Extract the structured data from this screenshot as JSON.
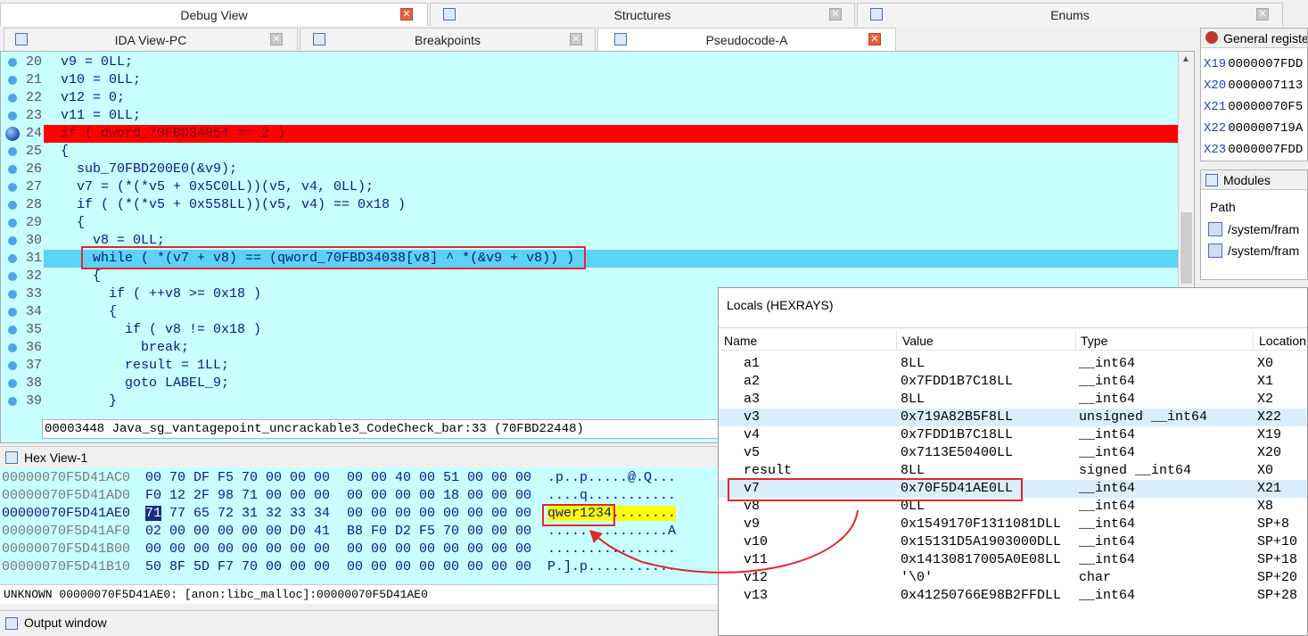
{
  "top_tabs": [
    {
      "label": "Debug View"
    },
    {
      "label": "Structures"
    },
    {
      "label": "Enums"
    }
  ],
  "sub_tabs": [
    {
      "label": "IDA View-PC"
    },
    {
      "label": "Breakpoints"
    },
    {
      "label": "Pseudocode-A"
    }
  ],
  "pseudocode": {
    "lines": [
      {
        "num": "20",
        "text": "v9 = 0LL;"
      },
      {
        "num": "21",
        "text": "v10 = 0LL;"
      },
      {
        "num": "22",
        "text": "v12 = 0;"
      },
      {
        "num": "23",
        "text": "v11 = 0LL;"
      },
      {
        "num": "24",
        "text": "if ( dword_70FBD34054 == 2 )"
      },
      {
        "num": "25",
        "text": "{"
      },
      {
        "num": "26",
        "text": "  sub_70FBD200E0(&v9);"
      },
      {
        "num": "27",
        "text": "  v7 = (*(*v5 + 0x5C0LL))(v5, v4, 0LL);"
      },
      {
        "num": "28",
        "text": "  if ( (*(*v5 + 0x558LL))(v5, v4) == 0x18 )"
      },
      {
        "num": "29",
        "text": "  {"
      },
      {
        "num": "30",
        "text": "    v8 = 0LL;"
      },
      {
        "num": "31",
        "text": "    while ( *(v7 + v8) == (qword_70FBD34038[v8] ^ *(&v9 + v8)) )"
      },
      {
        "num": "32",
        "text": "    {"
      },
      {
        "num": "33",
        "text": "      if ( ++v8 >= 0x18 )"
      },
      {
        "num": "34",
        "text": "      {"
      },
      {
        "num": "35",
        "text": "        if ( v8 != 0x18 )"
      },
      {
        "num": "36",
        "text": "          break;"
      },
      {
        "num": "37",
        "text": "        result = 1LL;"
      },
      {
        "num": "38",
        "text": "        goto LABEL_9;"
      },
      {
        "num": "39",
        "text": "      }"
      }
    ],
    "status": "00003448 Java_sg_vantagepoint_uncrackable3_CodeCheck_bar:33 (70FBD22448)"
  },
  "hex_view": {
    "title": "Hex View-1",
    "rows": [
      {
        "addr": "00000070F5D41AC0",
        "bytes1": "00 70 DF F5 70 00 00 00",
        "bytes2": "00 00 40 00 51 00 00 00",
        "ascii": ".p..p.....@.Q..."
      },
      {
        "addr": "00000070F5D41AD0",
        "bytes1": "F0 12 2F 98 71 00 00 00",
        "bytes2": "00 00 00 00 18 00 00 00",
        "ascii": "....q..........."
      },
      {
        "addr": "00000070F5D41AE0",
        "sel_byte": "71",
        "bytes1": " 77 65 72 31 32 33 34",
        "bytes2": "00 00 00 00 00 00 00 00",
        "ascii_hl": "qwer1234",
        "ascii": "........"
      },
      {
        "addr": "00000070F5D41AF0",
        "bytes1": "02 00 00 00 00 00 D0 41",
        "bytes2": "B8 F0 D2 F5 70 00 00 00",
        "ascii": "...............A"
      },
      {
        "addr": "00000070F5D41B00",
        "bytes1": "00 00 00 00 00 00 00 00",
        "bytes2": "00 00 00 00 00 00 00 00",
        "ascii": "................"
      },
      {
        "addr": "00000070F5D41B10",
        "bytes1": "50 8F 5D F7 70 00 00 00",
        "bytes2": "00 00 00 00 00 00 00 00",
        "ascii": "P.].p..........."
      }
    ],
    "status": "UNKNOWN 00000070F5D41AE0: [anon:libc_malloc]:00000070F5D41AE0"
  },
  "output_window": {
    "title": "Output window"
  },
  "registers": {
    "title": "General registe",
    "rows": [
      {
        "name": "X19",
        "value": "0000007FDD"
      },
      {
        "name": "X20",
        "value": "0000007113"
      },
      {
        "name": "X21",
        "value": "00000070F5"
      },
      {
        "name": "X22",
        "value": "000000719A"
      },
      {
        "name": "X23",
        "value": "0000007FDD"
      }
    ]
  },
  "modules": {
    "title": "Modules",
    "header": "Path",
    "rows": [
      {
        "path": "/system/fram"
      },
      {
        "path": "/system/fram"
      }
    ]
  },
  "locals": {
    "title": "Locals (HEXRAYS)",
    "columns": [
      "Name",
      "Value",
      "Type",
      "Location"
    ],
    "rows": [
      {
        "name": "a1",
        "value": "8LL",
        "type": "__int64",
        "loc": "X0"
      },
      {
        "name": "a2",
        "value": "0x7FDD1B7C18LL",
        "type": "__int64",
        "loc": "X1"
      },
      {
        "name": "a3",
        "value": "8LL",
        "type": "__int64",
        "loc": "X2"
      },
      {
        "name": "v3",
        "value": "0x719A82B5F8LL",
        "type": "unsigned __int64",
        "loc": "X22"
      },
      {
        "name": "v4",
        "value": "0x7FDD1B7C18LL",
        "type": "__int64",
        "loc": "X19"
      },
      {
        "name": "v5",
        "value": "0x7113E50400LL",
        "type": "__int64",
        "loc": "X20"
      },
      {
        "name": "result",
        "value": "8LL",
        "type": "signed __int64",
        "loc": "X0"
      },
      {
        "name": "v7",
        "value": "0x70F5D41AE0LL",
        "type": "__int64",
        "loc": "X21"
      },
      {
        "name": "v8",
        "value": "0LL",
        "type": "__int64",
        "loc": "X8"
      },
      {
        "name": "v9",
        "value": "0x1549170F1311081DLL",
        "type": "__int64",
        "loc": "SP+8"
      },
      {
        "name": "v10",
        "value": "0x15131D5A1903000DLL",
        "type": "__int64",
        "loc": "SP+10"
      },
      {
        "name": "v11",
        "value": "0x14130817005A0E08LL",
        "type": "__int64",
        "loc": "SP+18"
      },
      {
        "name": "v12",
        "value": "'\\0'",
        "type": "char",
        "loc": "SP+20"
      },
      {
        "name": "v13",
        "value": "0x41250766E98B2FFDLL",
        "type": "__int64",
        "loc": "SP+28"
      }
    ]
  },
  "colors": {
    "code_bg": "#c8ffff",
    "breakpoint_line": "#ff0000",
    "current_line": "#5cd2f5",
    "annotation": "#e0282d"
  }
}
